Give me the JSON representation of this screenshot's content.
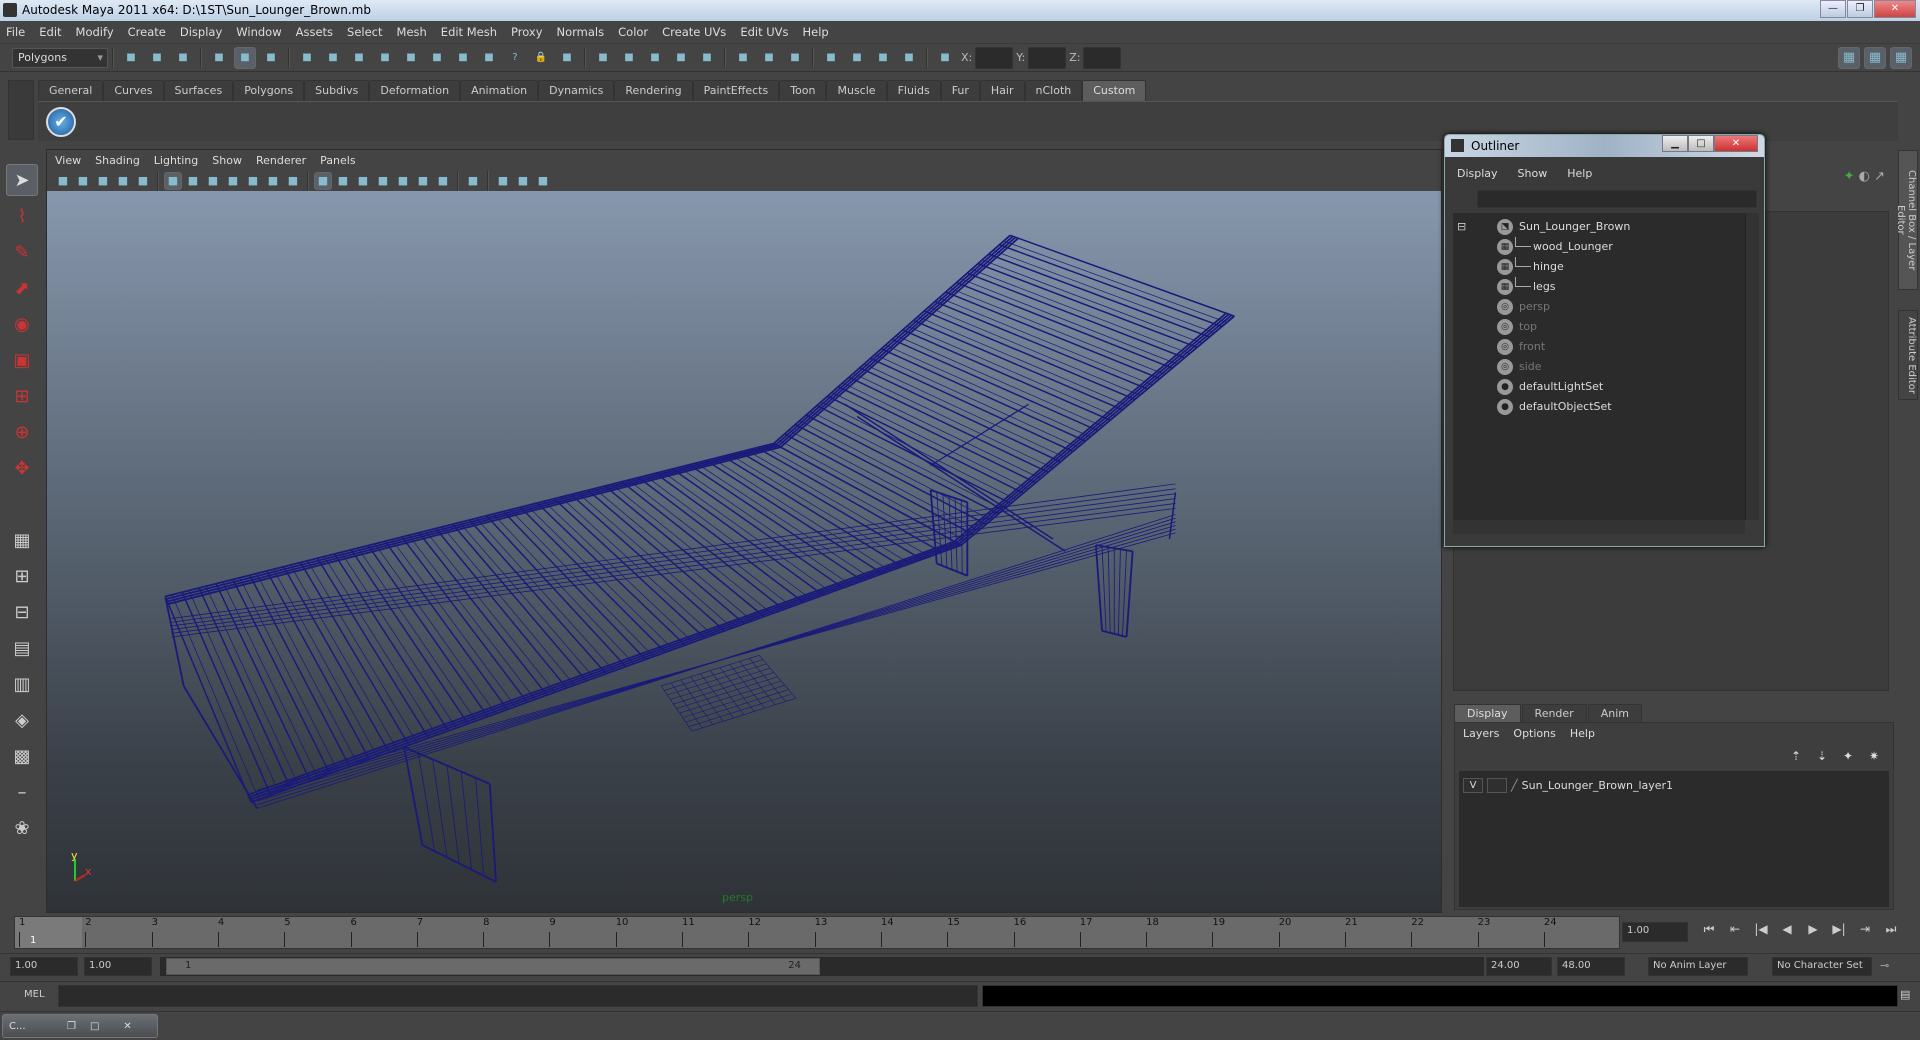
{
  "window": {
    "title": "Autodesk Maya 2011 x64: D:\\1ST\\Sun_Lounger_Brown.mb",
    "controls": [
      "—",
      "❐",
      "✕"
    ]
  },
  "menubar": [
    "File",
    "Edit",
    "Modify",
    "Create",
    "Display",
    "Window",
    "Assets",
    "Select",
    "Mesh",
    "Edit Mesh",
    "Proxy",
    "Normals",
    "Color",
    "Create UVs",
    "Edit UVs",
    "Help"
  ],
  "toolbar": {
    "mode": "Polygons",
    "coord_labels": {
      "x": "X:",
      "y": "Y:",
      "z": "Z:"
    },
    "icons": [
      "new-scene-icon",
      "open-scene-icon",
      "save-scene-icon",
      "|",
      "select-by-hierarchy-icon",
      "select-by-object-icon",
      "select-by-component-icon",
      "|",
      "filter-icon",
      "snap-grid-icon",
      "snap-curve-icon",
      "snap-point-icon",
      "snap-view-plane-icon",
      "snap-live-icon",
      "snap-vertex-icon",
      "snap-particle-icon",
      "help-icon",
      "lock-icon",
      "select-highlight-icon",
      "|",
      "construction-history-icon",
      "magnet-grid-icon",
      "magnet-curve-icon",
      "magnet-point-icon",
      "magnet-live-icon",
      "|",
      "input-ops-icon",
      "output-ops-icon",
      "history-icon",
      "|",
      "render-view-icon",
      "render-icon",
      "ipr-render-icon",
      "render-settings-icon",
      "|",
      "transform-icon"
    ],
    "right_icons": [
      "channel-box-toggle-icon",
      "attribute-editor-toggle-icon",
      "tool-settings-toggle-icon"
    ]
  },
  "shelf": {
    "tabs": [
      "General",
      "Curves",
      "Surfaces",
      "Polygons",
      "Subdivs",
      "Deformation",
      "Animation",
      "Dynamics",
      "Rendering",
      "PaintEffects",
      "Toon",
      "Muscle",
      "Fluids",
      "Fur",
      "Hair",
      "nCloth",
      "Custom"
    ],
    "active_tab": "Custom",
    "items": [
      "checkmark-icon"
    ]
  },
  "toolbox": [
    "select-tool-icon",
    "lasso-tool-icon",
    "paint-select-icon",
    "move-tool-icon",
    "rotate-tool-icon",
    "scale-tool-icon",
    "manipulator-icon",
    "soft-mod-icon",
    "show-manipulator-icon",
    "blank-icon",
    "single-pane-icon",
    "four-pane-icon",
    "two-pane-icon",
    "persp-outliner-icon",
    "persp-graph-icon",
    "hypershade-icon",
    "layout-icon",
    "minimize-icon",
    "paint-effects-icon"
  ],
  "viewport": {
    "menus": [
      "View",
      "Shading",
      "Lighting",
      "Show",
      "Renderer",
      "Panels"
    ],
    "icons": [
      "camera-icon",
      "camera-attr-icon",
      "bookmark-icon",
      "image-plane-icon",
      "camera-track-icon",
      "|",
      "grid-icon",
      "film-gate-icon",
      "resolution-gate-icon",
      "gate-mask-icon",
      "field-chart-icon",
      "safe-action-icon",
      "safe-title-icon",
      "|",
      "wireframe-icon",
      "smooth-shade-icon",
      "shaded-wire-icon",
      "textured-icon",
      "default-light-icon",
      "all-lights-icon",
      "use-lights-icon",
      "|",
      "select-camera-icon",
      "|",
      "isolate-icon",
      "xray-icon",
      "joint-xray-icon"
    ],
    "camera_label": "persp",
    "axis": {
      "x": "x",
      "y": "y"
    },
    "wire_color": "#1a1a7a"
  },
  "outliner": {
    "title": "Outliner",
    "menus": [
      "Display",
      "Show",
      "Help"
    ],
    "items": [
      {
        "label": "Sun_Lounger_Brown",
        "icon": "transform-group-icon",
        "expanded": true,
        "dim": false,
        "depth": 0
      },
      {
        "label": "wood_Lounger",
        "icon": "mesh-icon",
        "dim": false,
        "depth": 1
      },
      {
        "label": "hinge",
        "icon": "mesh-icon",
        "dim": false,
        "depth": 1
      },
      {
        "label": "legs",
        "icon": "mesh-icon",
        "dim": false,
        "depth": 1
      },
      {
        "label": "persp",
        "icon": "camera-icon",
        "dim": true,
        "depth": 0
      },
      {
        "label": "top",
        "icon": "camera-icon",
        "dim": true,
        "depth": 0
      },
      {
        "label": "front",
        "icon": "camera-icon",
        "dim": true,
        "depth": 0
      },
      {
        "label": "side",
        "icon": "camera-icon",
        "dim": true,
        "depth": 0
      },
      {
        "label": "defaultLightSet",
        "icon": "set-icon",
        "dim": false,
        "depth": 0
      },
      {
        "label": "defaultObjectSet",
        "icon": "set-icon",
        "dim": false,
        "depth": 0
      }
    ]
  },
  "side_tabs": [
    "Channel Box / Layer Editor",
    "Attribute Editor"
  ],
  "layer_editor": {
    "tabs": [
      "Display",
      "Render",
      "Anim"
    ],
    "active_tab": "Display",
    "menus": [
      "Layers",
      "Options",
      "Help"
    ],
    "layers": [
      {
        "visible": "V",
        "name": "Sun_Lounger_Brown_layer1"
      }
    ]
  },
  "timeline": {
    "ticks": [
      1,
      2,
      3,
      4,
      5,
      6,
      7,
      8,
      9,
      10,
      11,
      12,
      13,
      14,
      15,
      16,
      17,
      18,
      19,
      20,
      21,
      22,
      23,
      24
    ],
    "current_frame_marker": "1",
    "current_time": "1.00"
  },
  "range": {
    "start": "1.00",
    "anim_start": "1.00",
    "range_start": "1",
    "range_end": "24",
    "end": "24.00",
    "anim_end": "48.00",
    "anim_layer": "No Anim Layer",
    "character_set": "No Character Set"
  },
  "playback": [
    "go-start-icon",
    "step-back-key-icon",
    "step-back-icon",
    "play-back-icon",
    "play-forward-icon",
    "step-forward-icon",
    "step-forward-key-icon",
    "go-end-icon"
  ],
  "command_line": {
    "label": "MEL",
    "value": ""
  },
  "taskbar": {
    "item": "C..."
  }
}
